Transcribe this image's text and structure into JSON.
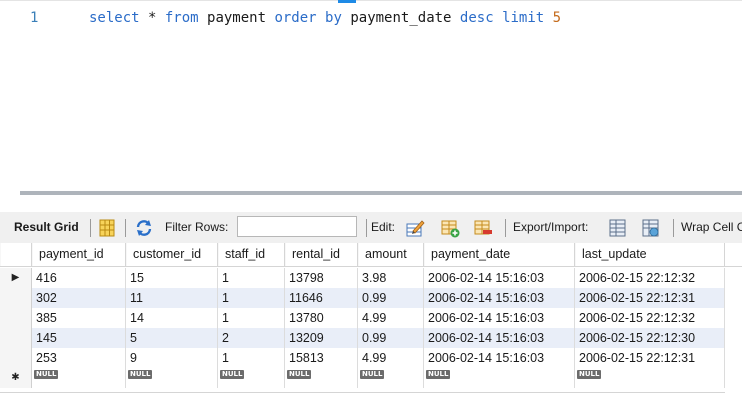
{
  "editor": {
    "line_number": "1",
    "tokens": [
      {
        "text": "select",
        "kind": "kw"
      },
      {
        "text": " * ",
        "kind": "plain"
      },
      {
        "text": "from",
        "kind": "kw"
      },
      {
        "text": " payment ",
        "kind": "plain"
      },
      {
        "text": "order",
        "kind": "kw"
      },
      {
        "text": " ",
        "kind": "plain"
      },
      {
        "text": "by",
        "kind": "kw"
      },
      {
        "text": " payment_date ",
        "kind": "plain"
      },
      {
        "text": "desc",
        "kind": "kw"
      },
      {
        "text": " ",
        "kind": "plain"
      },
      {
        "text": "limit",
        "kind": "kw"
      },
      {
        "text": " ",
        "kind": "plain"
      },
      {
        "text": "5",
        "kind": "num"
      }
    ],
    "colors": {
      "keyword": "#2b6cc8",
      "number": "#c46a1b"
    }
  },
  "toolbar": {
    "result_grid_label": "Result Grid",
    "filter_rows_label": "Filter Rows:",
    "filter_rows_value": "",
    "edit_label": "Edit:",
    "export_import_label": "Export/Import:",
    "wrap_cell_label": "Wrap Cell C"
  },
  "grid": {
    "columns": [
      "payment_id",
      "customer_id",
      "staff_id",
      "rental_id",
      "amount",
      "payment_date",
      "last_update"
    ],
    "rows": [
      [
        "416",
        "15",
        "1",
        "13798",
        "3.98",
        "2006-02-14 15:16:03",
        "2006-02-15 22:12:32"
      ],
      [
        "302",
        "11",
        "1",
        "11646",
        "0.99",
        "2006-02-14 15:16:03",
        "2006-02-15 22:12:31"
      ],
      [
        "385",
        "14",
        "1",
        "13780",
        "4.99",
        "2006-02-14 15:16:03",
        "2006-02-15 22:12:32"
      ],
      [
        "145",
        "5",
        "2",
        "13209",
        "0.99",
        "2006-02-14 15:16:03",
        "2006-02-15 22:12:30"
      ],
      [
        "253",
        "9",
        "1",
        "15813",
        "4.99",
        "2006-02-14 15:16:03",
        "2006-02-15 22:12:31"
      ]
    ],
    "null_label": "NULL",
    "current_row_marker": "▶",
    "new_row_marker": "✱",
    "alt_row_color": "#e9eef8"
  }
}
